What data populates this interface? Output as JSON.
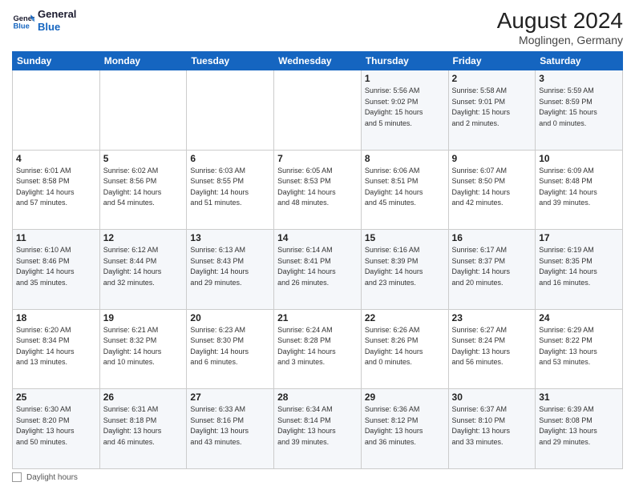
{
  "header": {
    "logo_line1": "General",
    "logo_line2": "Blue",
    "month_title": "August 2024",
    "location": "Moglingen, Germany"
  },
  "days_of_week": [
    "Sunday",
    "Monday",
    "Tuesday",
    "Wednesday",
    "Thursday",
    "Friday",
    "Saturday"
  ],
  "weeks": [
    [
      {
        "day": "",
        "info": ""
      },
      {
        "day": "",
        "info": ""
      },
      {
        "day": "",
        "info": ""
      },
      {
        "day": "",
        "info": ""
      },
      {
        "day": "1",
        "info": "Sunrise: 5:56 AM\nSunset: 9:02 PM\nDaylight: 15 hours\nand 5 minutes."
      },
      {
        "day": "2",
        "info": "Sunrise: 5:58 AM\nSunset: 9:01 PM\nDaylight: 15 hours\nand 2 minutes."
      },
      {
        "day": "3",
        "info": "Sunrise: 5:59 AM\nSunset: 8:59 PM\nDaylight: 15 hours\nand 0 minutes."
      }
    ],
    [
      {
        "day": "4",
        "info": "Sunrise: 6:01 AM\nSunset: 8:58 PM\nDaylight: 14 hours\nand 57 minutes."
      },
      {
        "day": "5",
        "info": "Sunrise: 6:02 AM\nSunset: 8:56 PM\nDaylight: 14 hours\nand 54 minutes."
      },
      {
        "day": "6",
        "info": "Sunrise: 6:03 AM\nSunset: 8:55 PM\nDaylight: 14 hours\nand 51 minutes."
      },
      {
        "day": "7",
        "info": "Sunrise: 6:05 AM\nSunset: 8:53 PM\nDaylight: 14 hours\nand 48 minutes."
      },
      {
        "day": "8",
        "info": "Sunrise: 6:06 AM\nSunset: 8:51 PM\nDaylight: 14 hours\nand 45 minutes."
      },
      {
        "day": "9",
        "info": "Sunrise: 6:07 AM\nSunset: 8:50 PM\nDaylight: 14 hours\nand 42 minutes."
      },
      {
        "day": "10",
        "info": "Sunrise: 6:09 AM\nSunset: 8:48 PM\nDaylight: 14 hours\nand 39 minutes."
      }
    ],
    [
      {
        "day": "11",
        "info": "Sunrise: 6:10 AM\nSunset: 8:46 PM\nDaylight: 14 hours\nand 35 minutes."
      },
      {
        "day": "12",
        "info": "Sunrise: 6:12 AM\nSunset: 8:44 PM\nDaylight: 14 hours\nand 32 minutes."
      },
      {
        "day": "13",
        "info": "Sunrise: 6:13 AM\nSunset: 8:43 PM\nDaylight: 14 hours\nand 29 minutes."
      },
      {
        "day": "14",
        "info": "Sunrise: 6:14 AM\nSunset: 8:41 PM\nDaylight: 14 hours\nand 26 minutes."
      },
      {
        "day": "15",
        "info": "Sunrise: 6:16 AM\nSunset: 8:39 PM\nDaylight: 14 hours\nand 23 minutes."
      },
      {
        "day": "16",
        "info": "Sunrise: 6:17 AM\nSunset: 8:37 PM\nDaylight: 14 hours\nand 20 minutes."
      },
      {
        "day": "17",
        "info": "Sunrise: 6:19 AM\nSunset: 8:35 PM\nDaylight: 14 hours\nand 16 minutes."
      }
    ],
    [
      {
        "day": "18",
        "info": "Sunrise: 6:20 AM\nSunset: 8:34 PM\nDaylight: 14 hours\nand 13 minutes."
      },
      {
        "day": "19",
        "info": "Sunrise: 6:21 AM\nSunset: 8:32 PM\nDaylight: 14 hours\nand 10 minutes."
      },
      {
        "day": "20",
        "info": "Sunrise: 6:23 AM\nSunset: 8:30 PM\nDaylight: 14 hours\nand 6 minutes."
      },
      {
        "day": "21",
        "info": "Sunrise: 6:24 AM\nSunset: 8:28 PM\nDaylight: 14 hours\nand 3 minutes."
      },
      {
        "day": "22",
        "info": "Sunrise: 6:26 AM\nSunset: 8:26 PM\nDaylight: 14 hours\nand 0 minutes."
      },
      {
        "day": "23",
        "info": "Sunrise: 6:27 AM\nSunset: 8:24 PM\nDaylight: 13 hours\nand 56 minutes."
      },
      {
        "day": "24",
        "info": "Sunrise: 6:29 AM\nSunset: 8:22 PM\nDaylight: 13 hours\nand 53 minutes."
      }
    ],
    [
      {
        "day": "25",
        "info": "Sunrise: 6:30 AM\nSunset: 8:20 PM\nDaylight: 13 hours\nand 50 minutes."
      },
      {
        "day": "26",
        "info": "Sunrise: 6:31 AM\nSunset: 8:18 PM\nDaylight: 13 hours\nand 46 minutes."
      },
      {
        "day": "27",
        "info": "Sunrise: 6:33 AM\nSunset: 8:16 PM\nDaylight: 13 hours\nand 43 minutes."
      },
      {
        "day": "28",
        "info": "Sunrise: 6:34 AM\nSunset: 8:14 PM\nDaylight: 13 hours\nand 39 minutes."
      },
      {
        "day": "29",
        "info": "Sunrise: 6:36 AM\nSunset: 8:12 PM\nDaylight: 13 hours\nand 36 minutes."
      },
      {
        "day": "30",
        "info": "Sunrise: 6:37 AM\nSunset: 8:10 PM\nDaylight: 13 hours\nand 33 minutes."
      },
      {
        "day": "31",
        "info": "Sunrise: 6:39 AM\nSunset: 8:08 PM\nDaylight: 13 hours\nand 29 minutes."
      }
    ]
  ],
  "footer": {
    "legend_label": "Daylight hours"
  }
}
